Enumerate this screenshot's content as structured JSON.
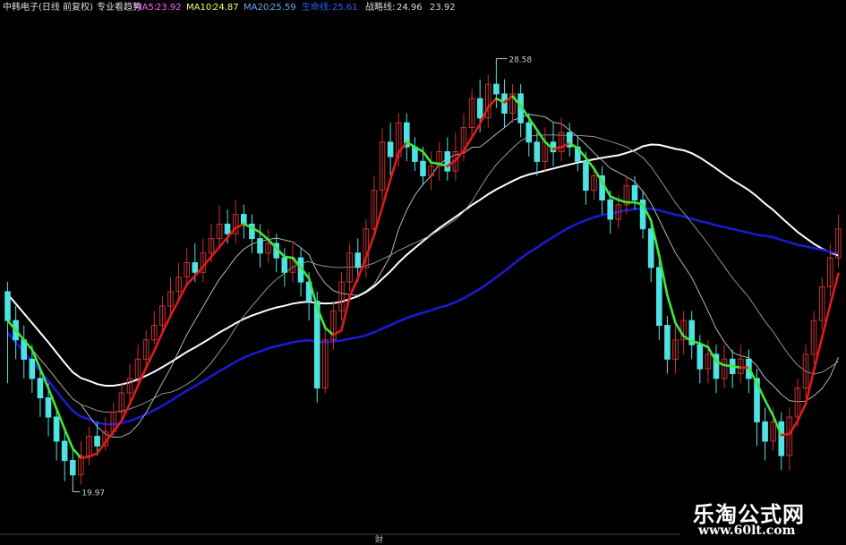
{
  "header": {
    "stock_name": "中韩电子(日线 前复权)",
    "indicator_name": "专业看趋势",
    "ma5_label": "MA5:",
    "ma5_value": "23.92",
    "ma10_label": "MA10:",
    "ma10_value": "24.87",
    "ma20_label": "MA20:",
    "ma20_value": "25.59",
    "extra_label": "生命线:",
    "extra_value": "25.61",
    "zhanlue_label": "战略线:",
    "zhanlue_value": "24.96",
    "last_value": "23.92"
  },
  "colors": {
    "background": "#000000",
    "up": "#c83030",
    "down": "#4fe2e2",
    "ma5_label": "#ff66ff",
    "ma10_label": "#ffff66",
    "ma20_label": "#66aaff",
    "extra_label": "#2a5fff",
    "ma_thin": "#c8c8c8",
    "ma_mid": "#9aa59a",
    "long_white": "#ffffff",
    "long_blue": "#1a1ad0",
    "trend_up": "#e11a1a",
    "trend_down": "#3ee83e"
  },
  "annotations": {
    "high_label": "28.58",
    "low_label": "19.97",
    "footer_mark": "财"
  },
  "watermark": {
    "title": "乐淘公式网",
    "url": "www.60lt.com"
  },
  "chart_data": {
    "type": "candlestick",
    "price_axis": {
      "min": 19.0,
      "max": 29.5
    },
    "n_bars": 103,
    "candles": [
      [
        23.9,
        23.3,
        24.1,
        22.0
      ],
      [
        23.3,
        22.9,
        23.6,
        22.5
      ],
      [
        22.9,
        22.5,
        23.2,
        22.1
      ],
      [
        22.5,
        22.1,
        22.8,
        21.8
      ],
      [
        22.1,
        21.7,
        22.3,
        21.3
      ],
      [
        21.7,
        21.3,
        22.0,
        20.9
      ],
      [
        21.3,
        20.8,
        21.5,
        20.4
      ],
      [
        20.8,
        20.4,
        21.0,
        19.97
      ],
      [
        20.4,
        20.1,
        20.7,
        19.9
      ],
      [
        20.1,
        20.5,
        20.8,
        19.9
      ],
      [
        20.5,
        20.9,
        21.1,
        20.3
      ],
      [
        20.9,
        20.7,
        21.2,
        20.5
      ],
      [
        20.7,
        21.0,
        21.3,
        20.6
      ],
      [
        21.0,
        21.4,
        21.6,
        20.9
      ],
      [
        21.4,
        21.8,
        22.0,
        21.2
      ],
      [
        21.8,
        22.1,
        22.4,
        21.6
      ],
      [
        22.1,
        22.5,
        22.8,
        22.0
      ],
      [
        22.5,
        22.9,
        23.1,
        22.3
      ],
      [
        22.9,
        23.2,
        23.5,
        22.8
      ],
      [
        23.2,
        23.6,
        23.8,
        23.0
      ],
      [
        23.6,
        23.9,
        24.2,
        23.4
      ],
      [
        23.9,
        24.2,
        24.5,
        23.7
      ],
      [
        24.2,
        24.5,
        24.8,
        24.0
      ],
      [
        24.5,
        24.3,
        24.9,
        24.1
      ],
      [
        24.3,
        24.7,
        25.0,
        24.1
      ],
      [
        24.7,
        25.0,
        25.3,
        24.5
      ],
      [
        25.0,
        25.3,
        25.7,
        24.8
      ],
      [
        25.3,
        25.1,
        25.6,
        24.9
      ],
      [
        25.1,
        25.5,
        25.8,
        24.9
      ],
      [
        25.5,
        25.3,
        25.7,
        25.0
      ],
      [
        25.3,
        25.0,
        25.5,
        24.7
      ],
      [
        25.0,
        24.7,
        25.3,
        24.4
      ],
      [
        24.7,
        24.9,
        25.2,
        24.5
      ],
      [
        24.9,
        24.6,
        25.1,
        24.3
      ],
      [
        24.6,
        24.3,
        24.8,
        24.0
      ],
      [
        24.3,
        24.6,
        24.9,
        24.1
      ],
      [
        24.6,
        24.1,
        24.8,
        23.8
      ],
      [
        24.1,
        23.7,
        24.3,
        23.3
      ],
      [
        23.7,
        21.9,
        23.9,
        21.6
      ],
      [
        21.9,
        22.9,
        23.2,
        21.8
      ],
      [
        22.9,
        23.5,
        23.7,
        22.7
      ],
      [
        23.5,
        24.1,
        24.3,
        23.3
      ],
      [
        24.1,
        24.7,
        24.9,
        23.9
      ],
      [
        24.7,
        24.4,
        25.0,
        24.1
      ],
      [
        24.4,
        25.2,
        25.4,
        24.2
      ],
      [
        25.2,
        26.0,
        26.3,
        25.0
      ],
      [
        26.0,
        27.0,
        27.3,
        25.8
      ],
      [
        27.0,
        26.7,
        27.4,
        26.3
      ],
      [
        26.7,
        27.4,
        27.6,
        26.5
      ],
      [
        27.4,
        26.9,
        27.6,
        26.6
      ],
      [
        26.9,
        26.6,
        27.1,
        26.4
      ],
      [
        26.6,
        26.3,
        26.9,
        26.1
      ],
      [
        26.3,
        26.5,
        26.8,
        26.0
      ],
      [
        26.5,
        26.8,
        27.0,
        26.2
      ],
      [
        26.8,
        26.4,
        27.1,
        26.2
      ],
      [
        26.4,
        26.8,
        27.2,
        26.2
      ],
      [
        26.8,
        27.3,
        27.6,
        26.6
      ],
      [
        27.3,
        27.9,
        28.1,
        27.1
      ],
      [
        27.9,
        27.5,
        28.3,
        27.2
      ],
      [
        27.5,
        28.2,
        28.4,
        27.3
      ],
      [
        28.2,
        28.0,
        28.58,
        27.7
      ],
      [
        28.0,
        27.6,
        28.3,
        27.3
      ],
      [
        27.6,
        28.0,
        28.2,
        27.4
      ],
      [
        28.0,
        27.4,
        28.2,
        27.1
      ],
      [
        27.4,
        27.0,
        27.6,
        26.7
      ],
      [
        27.0,
        26.6,
        27.2,
        26.3
      ],
      [
        26.6,
        27.0,
        27.3,
        26.4
      ],
      [
        27.0,
        26.8,
        27.4,
        26.5
      ],
      [
        26.8,
        27.2,
        27.5,
        26.6
      ],
      [
        27.2,
        26.9,
        27.4,
        26.7
      ],
      [
        26.9,
        26.6,
        27.1,
        26.4
      ],
      [
        26.6,
        26.0,
        26.8,
        25.7
      ],
      [
        26.0,
        26.3,
        26.5,
        25.8
      ],
      [
        26.3,
        25.8,
        26.5,
        25.5
      ],
      [
        25.8,
        25.4,
        26.0,
        25.1
      ],
      [
        25.4,
        25.7,
        25.9,
        25.2
      ],
      [
        25.7,
        26.1,
        26.3,
        25.5
      ],
      [
        26.1,
        25.8,
        26.3,
        25.6
      ],
      [
        25.8,
        25.2,
        26.0,
        25.0
      ],
      [
        25.2,
        24.4,
        25.4,
        24.1
      ],
      [
        24.4,
        23.2,
        24.6,
        22.9
      ],
      [
        23.2,
        22.5,
        23.4,
        22.2
      ],
      [
        22.5,
        22.9,
        23.2,
        22.2
      ],
      [
        22.9,
        23.3,
        23.5,
        22.6
      ],
      [
        23.3,
        22.8,
        23.5,
        22.5
      ],
      [
        22.8,
        22.3,
        23.0,
        22.0
      ],
      [
        22.3,
        22.6,
        22.9,
        22.0
      ],
      [
        22.6,
        22.1,
        22.8,
        21.8
      ],
      [
        22.1,
        22.5,
        22.8,
        21.9
      ],
      [
        22.5,
        22.2,
        22.7,
        21.9
      ],
      [
        22.2,
        22.5,
        22.8,
        22.0
      ],
      [
        22.5,
        22.1,
        22.7,
        21.8
      ],
      [
        22.1,
        21.2,
        22.3,
        20.7
      ],
      [
        21.2,
        20.8,
        21.5,
        20.4
      ],
      [
        20.8,
        21.2,
        21.5,
        20.6
      ],
      [
        21.2,
        20.5,
        21.4,
        20.2
      ],
      [
        20.5,
        21.3,
        21.5,
        20.2
      ],
      [
        21.3,
        21.9,
        22.1,
        21.1
      ],
      [
        21.9,
        22.6,
        22.8,
        21.7
      ],
      [
        22.6,
        23.3,
        23.5,
        22.4
      ],
      [
        23.3,
        24.0,
        24.2,
        23.1
      ],
      [
        24.0,
        24.6,
        24.9,
        23.8
      ],
      [
        24.6,
        25.2,
        25.5,
        24.4
      ]
    ]
  }
}
